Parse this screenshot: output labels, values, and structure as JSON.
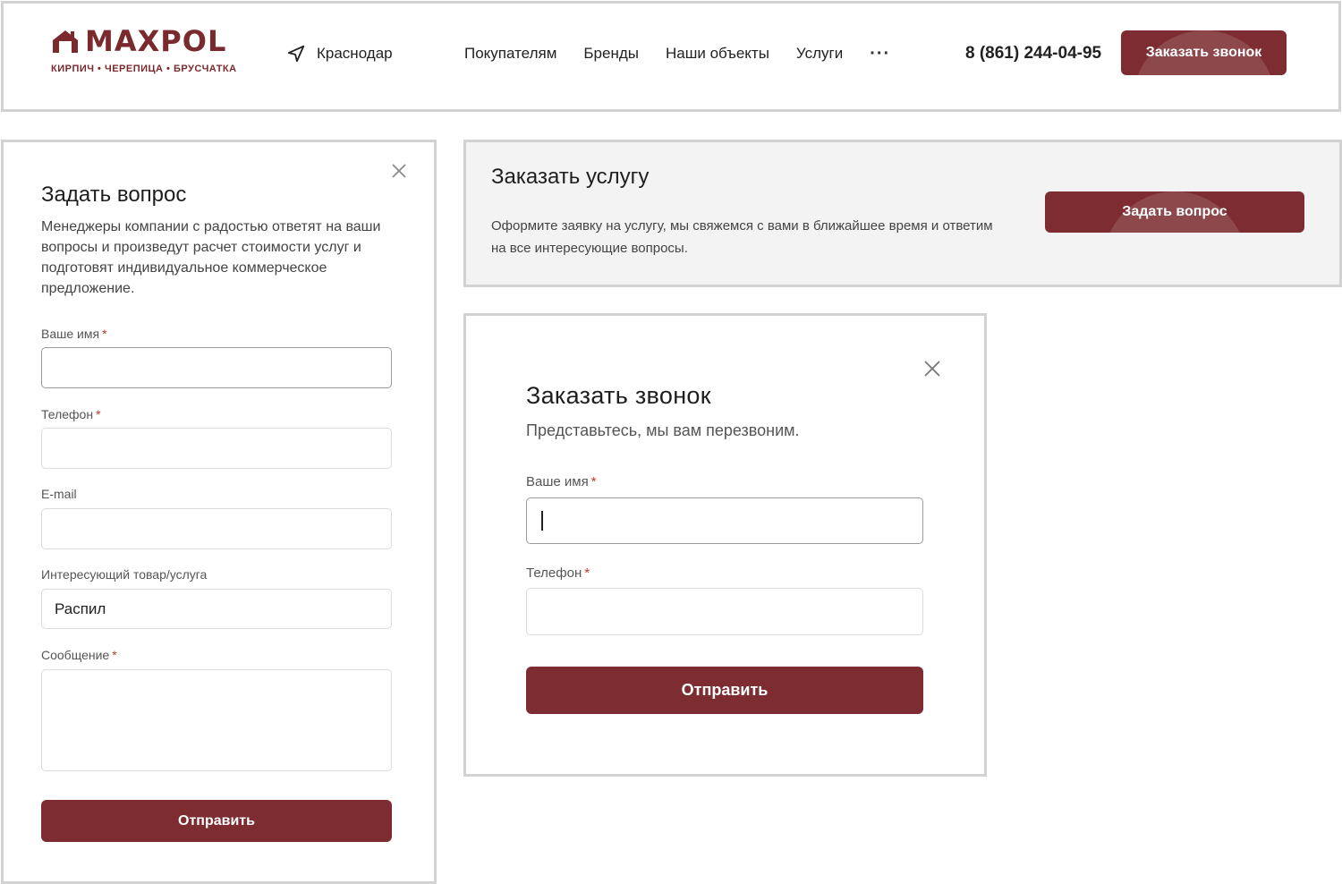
{
  "colors": {
    "brand": "#7d2d31",
    "border": "#d2d2d2",
    "required": "#c0392b"
  },
  "header": {
    "logo_text": "MAXPOL",
    "logo_tagline": "КИРПИЧ • ЧЕРЕПИЦА • БРУСЧАТКА",
    "logo_icon": "house-icon",
    "city_icon": "location-arrow-icon",
    "city": "Краснодар",
    "nav": [
      "Покупателям",
      "Бренды",
      "Наши объекты",
      "Услуги"
    ],
    "more": "···",
    "phone": "8 (861) 244-04-95",
    "call_button": "Заказать звонок"
  },
  "ask_modal": {
    "close_icon": "close-icon",
    "title": "Задать вопрос",
    "description": "Менеджеры компании с радостью ответят на ваши вопросы и произведут расчет стоимости услуг и подготовят индивидуальное коммерческое предложение.",
    "fields": {
      "name": {
        "label": "Ваше имя",
        "required": "*",
        "value": ""
      },
      "phone": {
        "label": "Телефон",
        "required": "*",
        "value": ""
      },
      "email": {
        "label": "E-mail",
        "value": ""
      },
      "product": {
        "label": "Интересующий товар/услуга",
        "value": "Распил"
      },
      "message": {
        "label": "Сообщение",
        "required": "*",
        "value": ""
      }
    },
    "submit": "Отправить"
  },
  "service_block": {
    "title": "Заказать услугу",
    "description": "Оформите заявку на услугу, мы свяжемся с вами в ближайшее время и ответим на все интересующие вопросы.",
    "button": "Задать вопрос"
  },
  "call_modal": {
    "close_icon": "close-icon",
    "title": "Заказать звонок",
    "subtitle": "Представьтесь, мы вам перезвоним.",
    "fields": {
      "name": {
        "label": "Ваше имя",
        "required": "*",
        "value": ""
      },
      "phone": {
        "label": "Телефон",
        "required": "*",
        "value": ""
      }
    },
    "submit": "Отправить"
  }
}
